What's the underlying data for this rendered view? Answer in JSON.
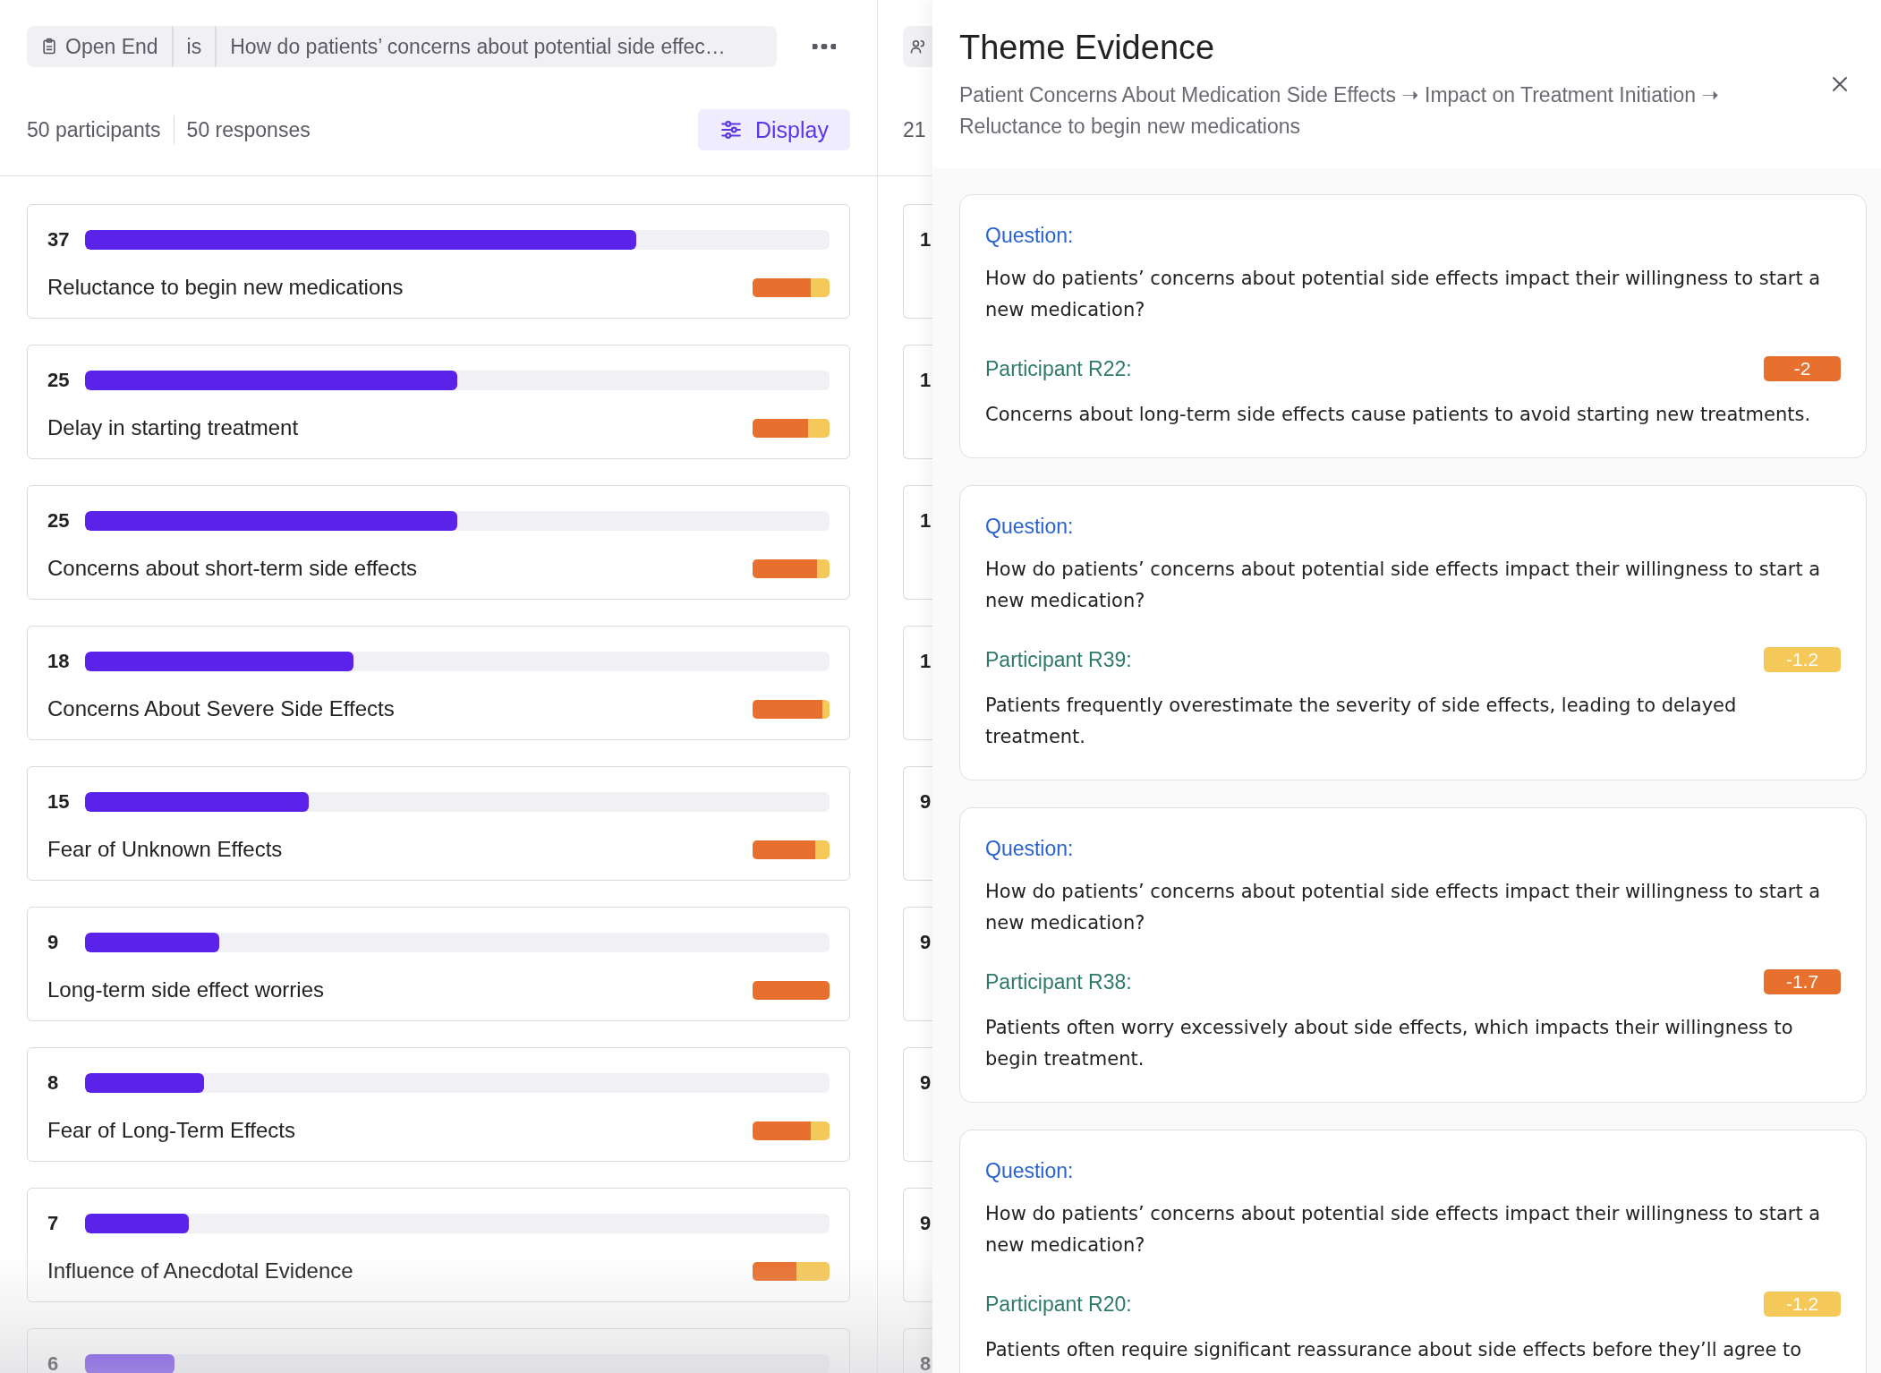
{
  "filter": {
    "field": "Open End",
    "operator": "is",
    "value": "How do patients’ concerns about potential side effec…"
  },
  "stats": {
    "participants": "50 participants",
    "responses": "50 responses"
  },
  "display_button": "Display",
  "themes": [
    {
      "count": "37",
      "level": 0.74,
      "label": "Reluctance to begin new medications",
      "sentiment": {
        "level": 0.75
      }
    },
    {
      "count": "25",
      "level": 0.5,
      "label": "Delay in starting treatment",
      "sentiment": {
        "level": 0.72
      }
    },
    {
      "count": "25",
      "level": 0.5,
      "label": "Concerns about short-term side effects",
      "sentiment": {
        "level": 0.84
      }
    },
    {
      "count": "18",
      "level": 0.36,
      "label": "Concerns About Severe Side Effects",
      "sentiment": {
        "level": 0.91
      }
    },
    {
      "count": "15",
      "level": 0.3,
      "label": "Fear of Unknown Effects",
      "sentiment": {
        "level": 0.81
      }
    },
    {
      "count": "9",
      "level": 0.18,
      "label": "Long-term side effect worries",
      "sentiment": {
        "level": 1
      }
    },
    {
      "count": "8",
      "level": 0.16,
      "label": "Fear of Long-Term Effects",
      "sentiment": {
        "level": 0.75
      }
    },
    {
      "count": "7",
      "level": 0.14,
      "label": "Influence of Anecdotal Evidence",
      "sentiment": {
        "level": 0.57
      }
    },
    {
      "count": "6",
      "level": 0.12
    }
  ],
  "second_column": {
    "count": "21",
    "cards": [
      {
        "count": "1"
      },
      {
        "count": "1"
      },
      {
        "count": "1"
      },
      {
        "count": "1"
      },
      {
        "count": "9"
      },
      {
        "count": "9"
      },
      {
        "count": "9"
      },
      {
        "count": "9"
      },
      {
        "count": "8"
      }
    ]
  },
  "panel": {
    "title": "Theme Evidence",
    "breadcrumb": "Patient Concerns About Medication Side Effects ➝ Impact on Treatment Initiation ➝ Reluctance to begin new medications",
    "evidence": [
      {
        "question_label": "Question:",
        "question": "How do patients’ concerns about potential side effects impact their willingness to start a new medication?",
        "participant": "Participant R22:",
        "score": "-2",
        "color": "#e8702e",
        "answer": "Concerns about long-term side effects cause patients to avoid starting new treatments."
      },
      {
        "question_label": "Question:",
        "question": "How do patients’ concerns about potential side effects impact their willingness to start a new medication?",
        "participant": "Participant R39:",
        "score": "-1.2",
        "color": "#f5c85a",
        "answer": "Patients frequently overestimate the severity of side effects, leading to delayed treatment."
      },
      {
        "question_label": "Question:",
        "question": "How do patients’ concerns about potential side effects impact their willingness to start a new medication?",
        "participant": "Participant R38:",
        "score": "-1.7",
        "color": "#e8702e",
        "answer": "Patients often worry excessively about side effects, which impacts their willingness to begin treatment."
      },
      {
        "question_label": "Question:",
        "question": "How do patients’ concerns about potential side effects impact their willingness to start a new medication?",
        "participant": "Participant R20:",
        "score": "-1.2",
        "color": "#f5c85a",
        "answer": "Patients often require significant reassurance about side effects before they’ll agree to"
      }
    ]
  }
}
